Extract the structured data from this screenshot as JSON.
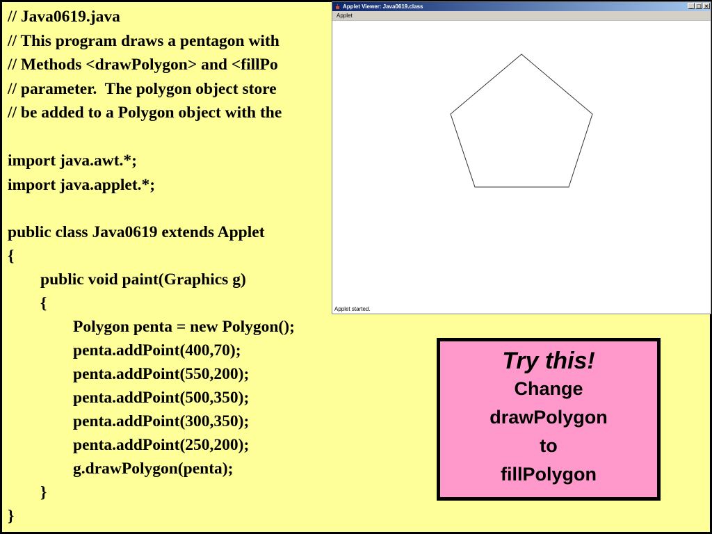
{
  "code": {
    "lines": [
      "// Java0619.java",
      "// This program draws a pentagon with",
      "// Methods <drawPolygon> and <fillPo",
      "// parameter.  The polygon object store",
      "// be added to a Polygon object with the",
      "",
      "import java.awt.*;",
      "import java.applet.*;",
      "",
      "public class Java0619 extends Applet",
      "{",
      "        public void paint(Graphics g)",
      "        {",
      "                Polygon penta = new Polygon();",
      "                penta.addPoint(400,70);",
      "                penta.addPoint(550,200);",
      "                penta.addPoint(500,350);",
      "                penta.addPoint(300,350);",
      "                penta.addPoint(250,200);",
      "                g.drawPolygon(penta);",
      "        }",
      "}"
    ]
  },
  "applet_window": {
    "title": "Applet Viewer: Java0619.class",
    "menu": "Applet",
    "status": "Applet started.",
    "controls": {
      "minimize": "_",
      "maximize": "□",
      "close": "×"
    }
  },
  "try_box": {
    "title": "Try this!",
    "lines": [
      "Change",
      "drawPolygon",
      "to",
      "fillPolygon"
    ]
  },
  "colors": {
    "code_background": "#ffff99",
    "callout_background": "#ff99cc",
    "titlebar": "#0a246a"
  }
}
